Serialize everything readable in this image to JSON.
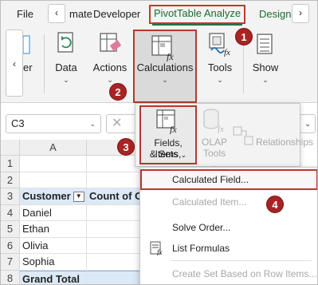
{
  "tabs": {
    "file": "File",
    "partial": "mate",
    "developer": "Developer",
    "pivot_analyze": "PivotTable Analyze",
    "design": "Design"
  },
  "ribbon": {
    "filter_partial": "er",
    "data": "Data",
    "actions": "Actions",
    "calculations": "Calculations",
    "tools": "Tools",
    "show": "Show"
  },
  "formula_bar": {
    "name_box": "C3",
    "cancel": "✕"
  },
  "calc_panel": {
    "fields_line1": "Fields, Items,",
    "fields_line2": "& Sets",
    "olap_line1": "OLAP",
    "olap_line2": "Tools",
    "relationships": "Relationships"
  },
  "menu": {
    "calculated_field": "Calculated Field...",
    "calculated_item": "Calculated Item...",
    "solve_order": "Solve Order...",
    "list_formulas": "List Formulas",
    "create_set": "Create Set Based on Row Items..."
  },
  "grid": {
    "col_a": "A",
    "rows": [
      "1",
      "2",
      "3",
      "4",
      "5",
      "6",
      "7",
      "8"
    ],
    "header_customer": "Customer",
    "header_count": "Count of O",
    "customers": [
      "Daniel",
      "Ethan",
      "Olivia",
      "Sophia"
    ],
    "grand_total": "Grand Total"
  },
  "badges": [
    "1",
    "2",
    "3",
    "4"
  ],
  "colors": {
    "accent_green": "#217346",
    "highlight_red": "#b03a2e",
    "pivot_header_blue": "#dce9f7",
    "badge_red": "#a82424"
  }
}
